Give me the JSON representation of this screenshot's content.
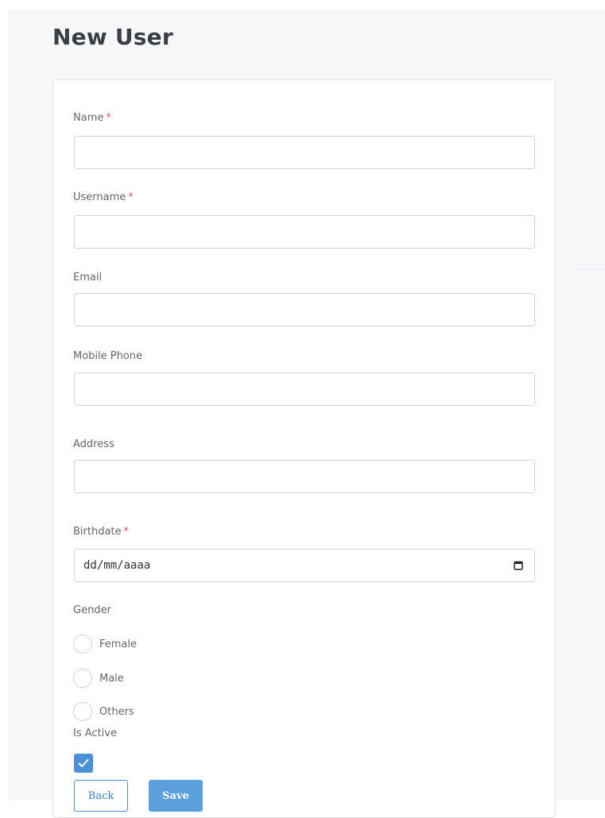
{
  "page": {
    "title": "New User"
  },
  "form": {
    "name": {
      "label": "Name",
      "required_mark": "*",
      "value": ""
    },
    "username": {
      "label": "Username",
      "required_mark": "*",
      "value": ""
    },
    "email": {
      "label": "Email",
      "value": ""
    },
    "mobile_phone": {
      "label": "Mobile Phone",
      "value": ""
    },
    "address": {
      "label": "Address",
      "value": ""
    },
    "birthdate": {
      "label": "Birthdate",
      "required_mark": "*",
      "placeholder": "dd/mm/aaaa"
    },
    "gender": {
      "label": "Gender",
      "options": [
        "Female",
        "Male",
        "Others"
      ],
      "selected": null
    },
    "is_active": {
      "label": "Is Active",
      "checked": true
    },
    "buttons": {
      "back": "Back",
      "save": "Save"
    }
  },
  "colors": {
    "accent": "#4a90d9",
    "required": "#e05555",
    "background": "#f5f7f9"
  },
  "icons": {
    "date_picker": "calendar-icon",
    "checkbox": "checkmark-icon"
  }
}
